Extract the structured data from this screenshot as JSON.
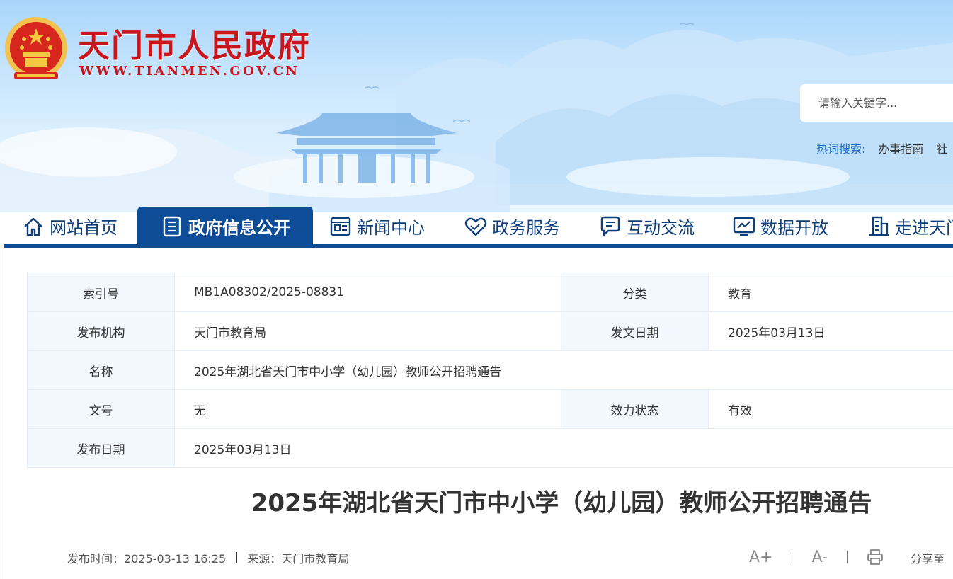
{
  "header": {
    "site_title": "天门市人民政府",
    "site_url": "WWW.TIANMEN.GOV.CN",
    "search_placeholder": "请输入关键字...",
    "hot_search_label": "热词搜索:",
    "hot_words": [
      "办事指南",
      "社"
    ]
  },
  "nav": {
    "items": [
      {
        "label": "网站首页",
        "icon": "home-icon"
      },
      {
        "label": "政府信息公开",
        "icon": "document-list-icon",
        "active": true
      },
      {
        "label": "新闻中心",
        "icon": "newspaper-icon"
      },
      {
        "label": "政务服务",
        "icon": "heart-handshake-icon"
      },
      {
        "label": "互动交流",
        "icon": "chat-icon"
      },
      {
        "label": "数据开放",
        "icon": "chart-monitor-icon"
      },
      {
        "label": "走进天门",
        "icon": "building-icon"
      }
    ]
  },
  "meta": {
    "index_label": "索引号",
    "index_value": "MB1A08302/2025-08831",
    "category_label": "分类",
    "category_value": "教育",
    "publisher_label": "发布机构",
    "publisher_value": "天门市教育局",
    "doc_date_label": "发文日期",
    "doc_date_value": "2025年03月13日",
    "name_label": "名称",
    "name_value": "2025年湖北省天门市中小学（幼儿园）教师公开招聘通告",
    "doc_no_label": "文号",
    "doc_no_value": "无",
    "status_label": "效力状态",
    "status_value": "有效",
    "pub_date_label": "发布日期",
    "pub_date_value": "2025年03月13日"
  },
  "article": {
    "title": "2025年湖北省天门市中小学（幼儿园）教师公开招聘通告",
    "publish_time": "发布时间：2025-03-13 16:25",
    "source": "来源：天门市教育局",
    "font_increase": "A+",
    "font_decrease": "A-",
    "share_label": "分享至"
  },
  "colors": {
    "brand_red": "#c8161d",
    "nav_blue": "#0e4c97",
    "table_key_bg": "#f2f8fe"
  }
}
